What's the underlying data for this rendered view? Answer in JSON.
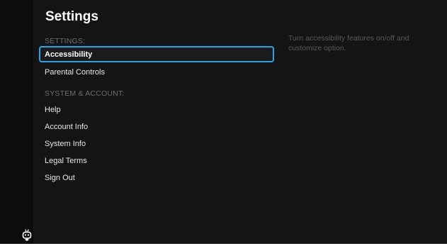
{
  "header": {
    "title": "Settings"
  },
  "sections": [
    {
      "label": "SETTINGS:",
      "items": [
        "Accessibility",
        "Parental Controls"
      ]
    },
    {
      "label": "SYSTEM & ACCOUNT:",
      "items": [
        "Help",
        "Account Info",
        "System Info",
        "Legal Terms",
        "Sign Out"
      ]
    }
  ],
  "selected_item": "Accessibility",
  "detail": {
    "description": "Turn accessibility features on/off and customize option."
  },
  "colors": {
    "background": "#141414",
    "focus_border": "#23a6e8",
    "text_primary": "#ffffff",
    "text_section": "#6f6f6f",
    "text_description": "#5a5a5a"
  },
  "icons": {
    "logo": "tv-mascot-icon"
  }
}
